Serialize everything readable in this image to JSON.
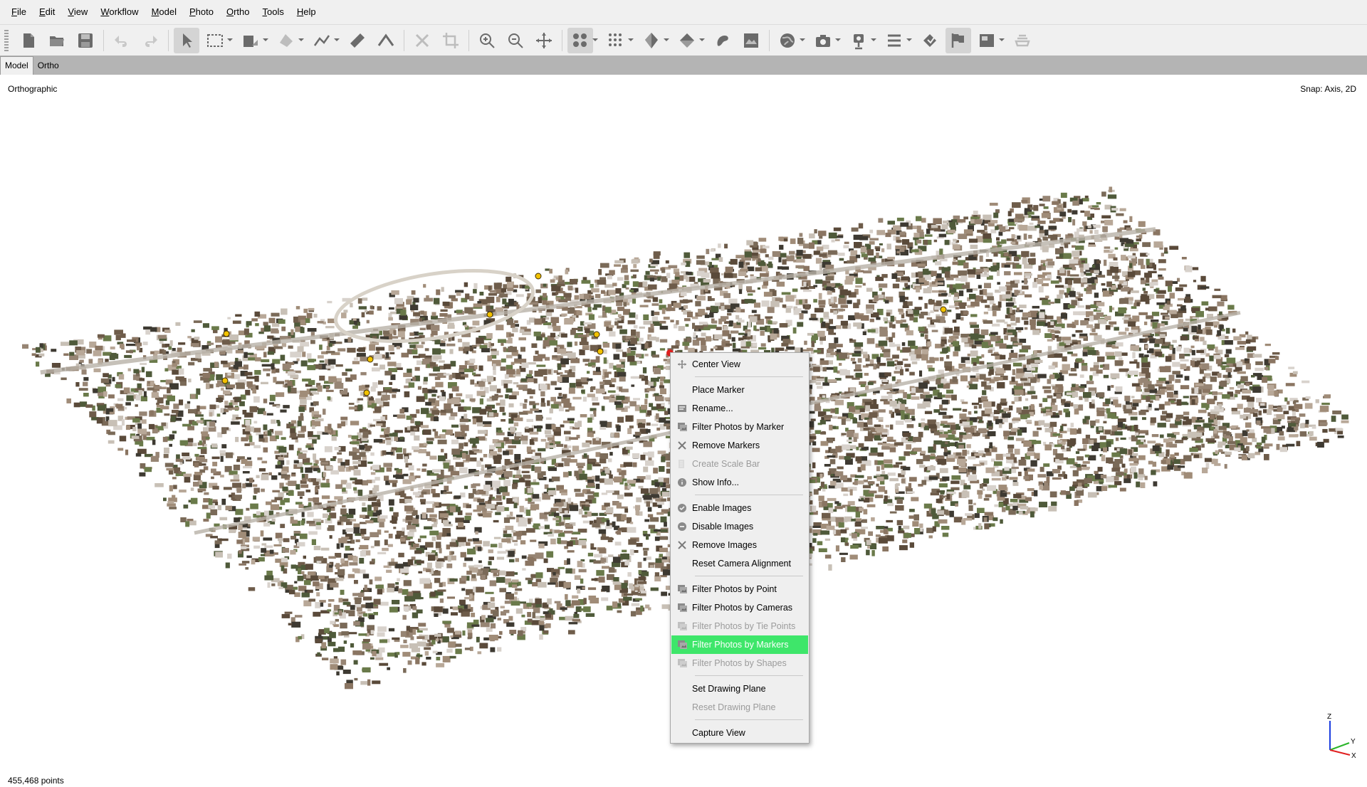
{
  "menu": [
    "File",
    "Edit",
    "View",
    "Workflow",
    "Model",
    "Photo",
    "Ortho",
    "Tools",
    "Help"
  ],
  "toolbar": [
    {
      "name": "new-icon"
    },
    {
      "name": "open-icon"
    },
    {
      "name": "save-icon"
    },
    {
      "sep": true
    },
    {
      "name": "undo-icon"
    },
    {
      "name": "redo-icon"
    },
    {
      "sep": true
    },
    {
      "name": "navigation-arrow-icon",
      "active": true
    },
    {
      "name": "rectangle-selection-icon",
      "dd": true
    },
    {
      "name": "draw-shape-icon",
      "dd": true
    },
    {
      "name": "draw-polygon-icon",
      "dd": true
    },
    {
      "name": "ruler-polyline-icon",
      "dd": true
    },
    {
      "name": "ruler-icon"
    },
    {
      "name": "angle-icon"
    },
    {
      "sep": true
    },
    {
      "name": "delete-selection-icon"
    },
    {
      "name": "crop-selection-icon"
    },
    {
      "sep": true
    },
    {
      "name": "zoom-in-icon"
    },
    {
      "name": "zoom-out-icon"
    },
    {
      "name": "reset-view-icon"
    },
    {
      "sep": true
    },
    {
      "name": "point-cloud-icon",
      "active": true,
      "dd": true
    },
    {
      "name": "dense-cloud-icon",
      "dd": true
    },
    {
      "name": "model-shaded-icon",
      "dd": true
    },
    {
      "name": "tiled-model-icon",
      "dd": true
    },
    {
      "name": "texture-icon"
    },
    {
      "name": "dem-icon"
    },
    {
      "sep": true
    },
    {
      "name": "globe-icon",
      "dd": true
    },
    {
      "name": "camera-icon",
      "dd": true
    },
    {
      "name": "show-cameras-icon",
      "dd": true
    },
    {
      "name": "shapes-list-icon",
      "dd": true
    },
    {
      "name": "markers-icon"
    },
    {
      "name": "flags-icon",
      "active": true
    },
    {
      "name": "image-overlay-icon",
      "dd": true
    },
    {
      "name": "region-icon"
    }
  ],
  "tabs": [
    {
      "label": "Model",
      "active": true
    },
    {
      "label": "Ortho",
      "active": false
    }
  ],
  "viewport": {
    "projection_label": "Orthographic",
    "snap_label": "Snap: Axis, 2D",
    "points_label": "455,468 points",
    "axes": {
      "z": "Z",
      "y": "Y",
      "x": "X"
    }
  },
  "context_menu": {
    "items": [
      {
        "label": "Center View",
        "icon": "center-view-icon",
        "enabled": true
      },
      {
        "sep": true
      },
      {
        "label": "Place Marker",
        "icon": "",
        "enabled": true
      },
      {
        "label": "Rename...",
        "icon": "rename-icon",
        "enabled": true
      },
      {
        "label": "Filter Photos by Marker",
        "icon": "filter-photos-icon",
        "enabled": true
      },
      {
        "label": "Remove Markers",
        "icon": "remove-x-icon",
        "enabled": true
      },
      {
        "label": "Create Scale Bar",
        "icon": "scale-bar-icon",
        "enabled": false
      },
      {
        "label": "Show Info...",
        "icon": "info-icon",
        "enabled": true
      },
      {
        "sep": true
      },
      {
        "label": "Enable Images",
        "icon": "enable-check-icon",
        "enabled": true
      },
      {
        "label": "Disable Images",
        "icon": "disable-minus-icon",
        "enabled": true
      },
      {
        "label": "Remove Images",
        "icon": "remove-x-icon",
        "enabled": true
      },
      {
        "label": "Reset Camera Alignment",
        "icon": "",
        "enabled": true
      },
      {
        "sep": true
      },
      {
        "label": "Filter Photos by Point",
        "icon": "filter-photos-icon",
        "enabled": true
      },
      {
        "label": "Filter Photos by Cameras",
        "icon": "filter-photos-icon",
        "enabled": true
      },
      {
        "label": "Filter Photos by Tie Points",
        "icon": "filter-photos-icon",
        "enabled": false
      },
      {
        "label": "Filter Photos by Markers",
        "icon": "filter-photos-icon",
        "enabled": true,
        "highlighted": true
      },
      {
        "label": "Filter Photos by Shapes",
        "icon": "filter-photos-icon",
        "enabled": false
      },
      {
        "sep": true
      },
      {
        "label": "Set Drawing Plane",
        "icon": "",
        "enabled": true
      },
      {
        "label": "Reset Drawing Plane",
        "icon": "",
        "enabled": false
      },
      {
        "sep": true
      },
      {
        "label": "Capture View",
        "icon": "",
        "enabled": true
      }
    ]
  },
  "colors": {
    "highlight": "#3ee66a",
    "marker": "#f2c200",
    "selected_marker": "#e02020"
  }
}
